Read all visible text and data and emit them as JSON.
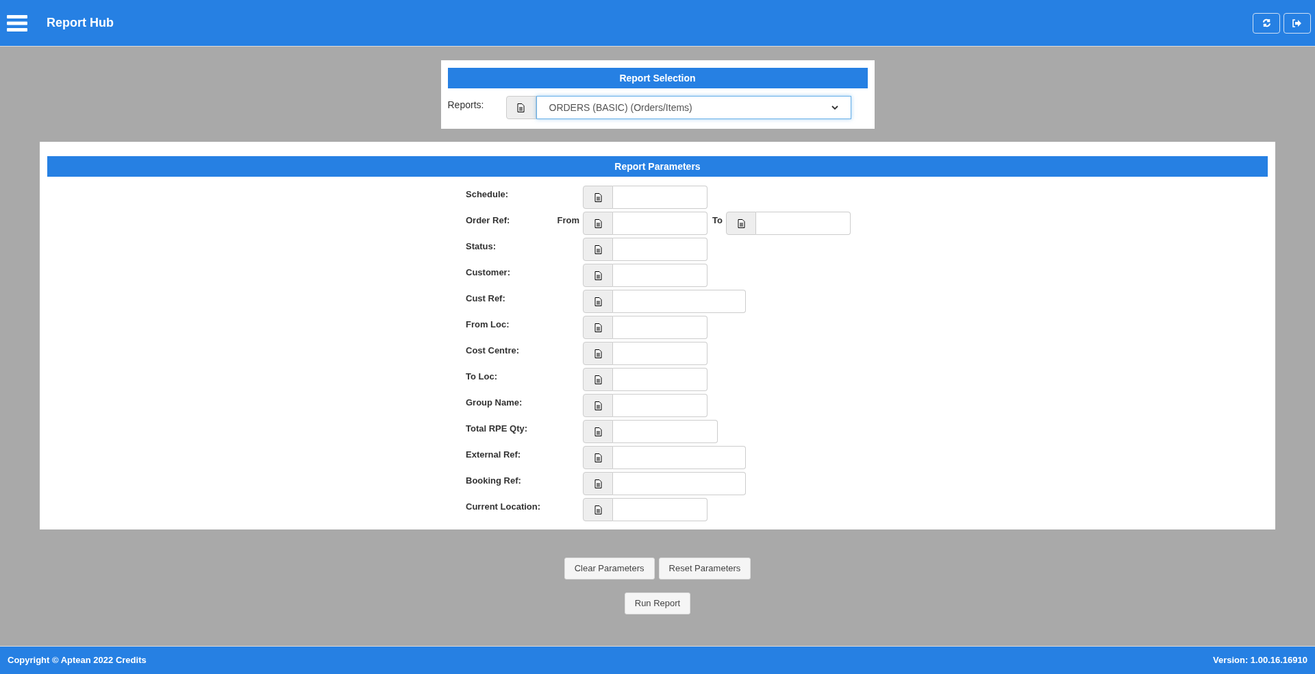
{
  "header": {
    "title": "Report Hub"
  },
  "report_selection": {
    "title": "Report Selection",
    "label": "Reports:",
    "value": "ORDERS (BASIC) (Orders/Items)"
  },
  "report_parameters": {
    "title": "Report Parameters",
    "fields": [
      {
        "label": "Schedule:",
        "kind": "short"
      },
      {
        "label": "Order Ref:",
        "kind": "range",
        "from_label": "From",
        "to_label": "To"
      },
      {
        "label": "Status:",
        "kind": "short"
      },
      {
        "label": "Customer:",
        "kind": "short"
      },
      {
        "label": "Cust Ref:",
        "kind": "long"
      },
      {
        "label": "From Loc:",
        "kind": "short"
      },
      {
        "label": "Cost Centre:",
        "kind": "short"
      },
      {
        "label": "To Loc:",
        "kind": "short"
      },
      {
        "label": "Group Name:",
        "kind": "short"
      },
      {
        "label": "Total RPE Qty:",
        "kind": "medium"
      },
      {
        "label": "External Ref:",
        "kind": "long"
      },
      {
        "label": "Booking Ref:",
        "kind": "long"
      },
      {
        "label": "Current Location:",
        "kind": "short"
      }
    ]
  },
  "actions": [
    "Clear Parameters",
    "Reset Parameters"
  ],
  "run_button": "Run Report",
  "footer": {
    "copyright": "Copyright © Aptean 2022 Credits",
    "version": "Version: 1.00.16.16910"
  }
}
